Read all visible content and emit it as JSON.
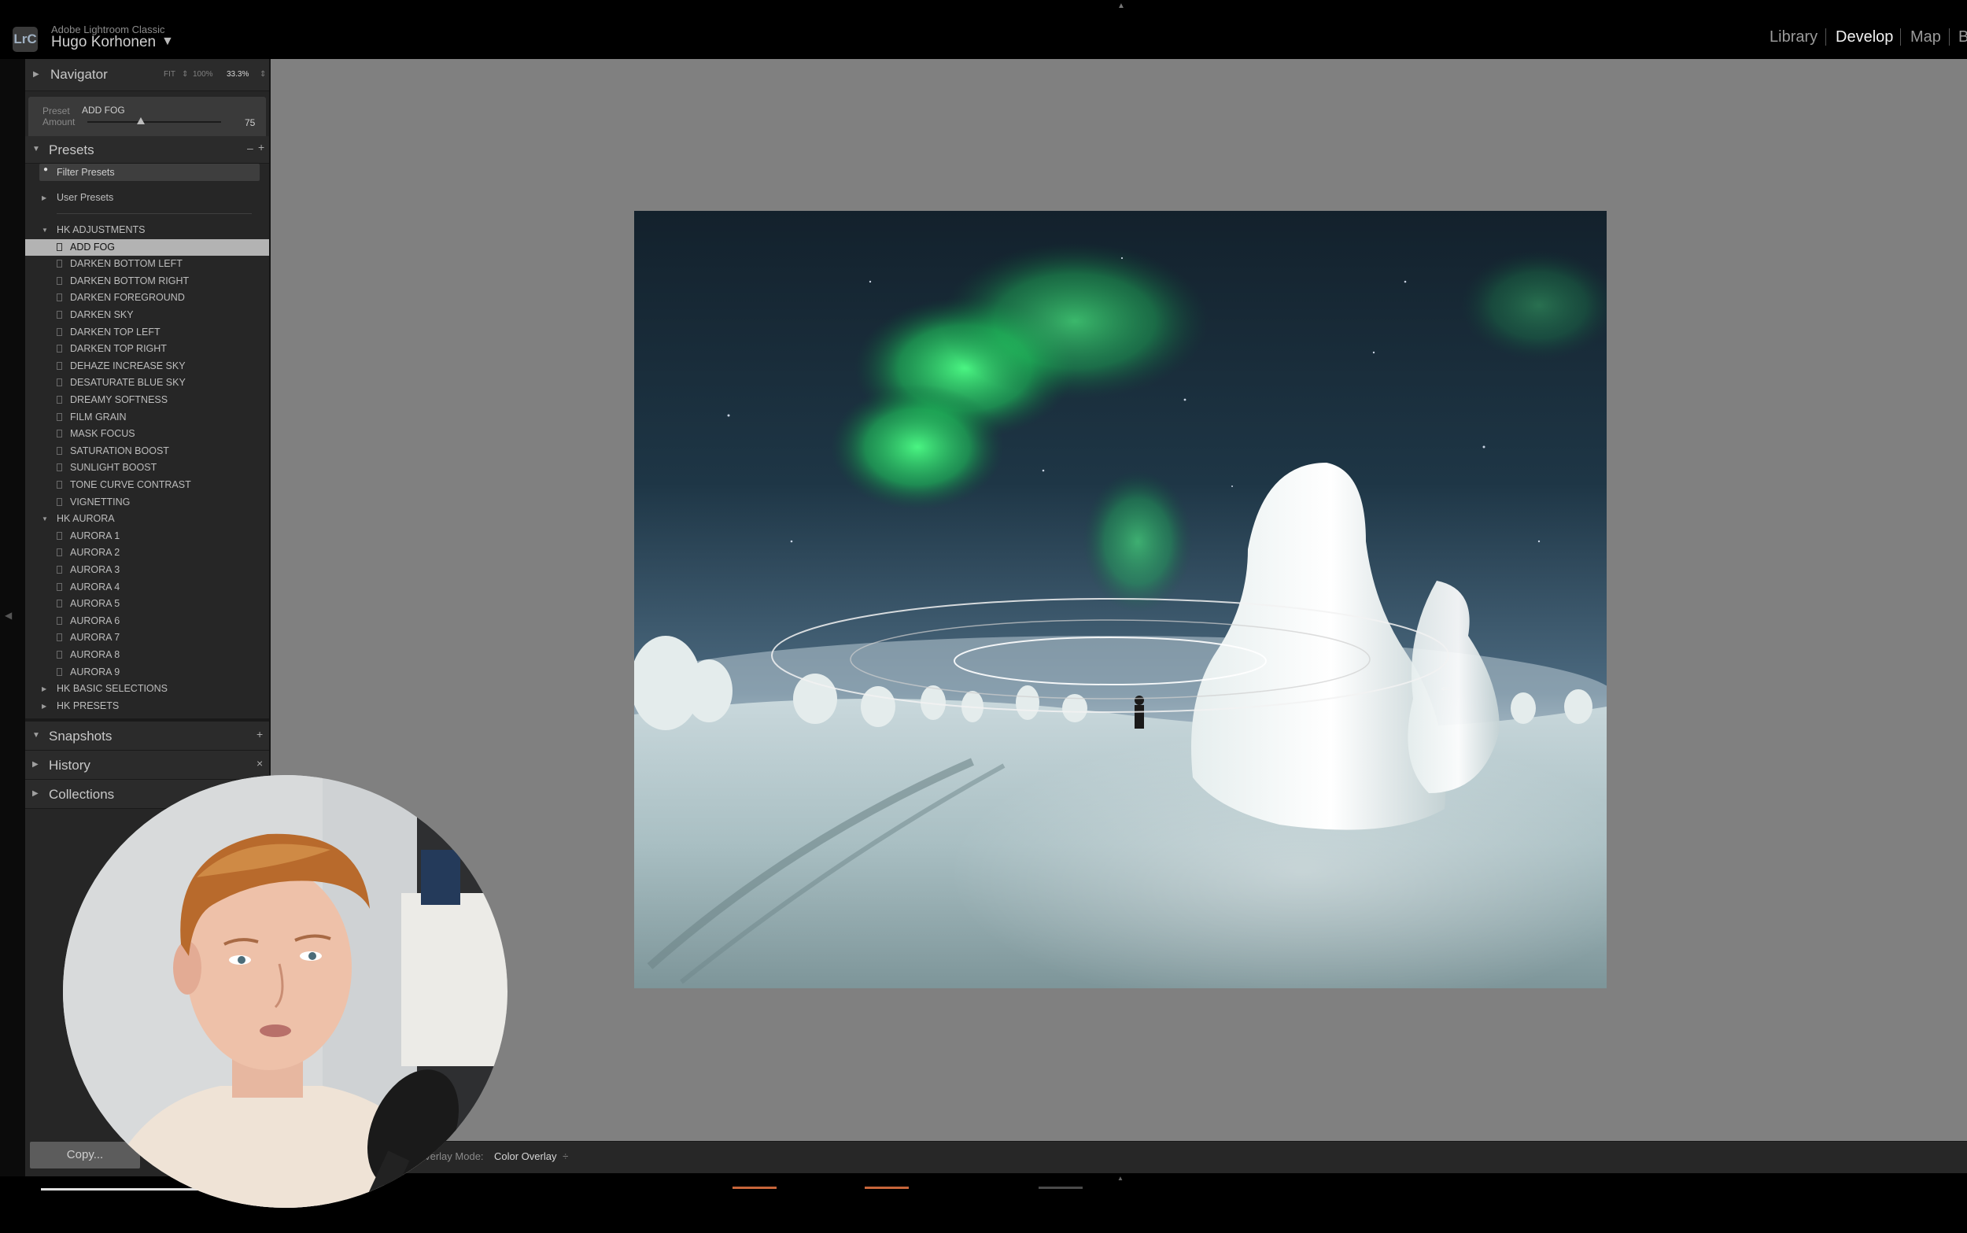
{
  "app": {
    "logo": "LrC",
    "name": "Adobe Lightroom Classic",
    "user": "Hugo Korhonen",
    "user_caret": "▼"
  },
  "modules": [
    "Library",
    "Develop",
    "Map",
    "B"
  ],
  "active_module": "Develop",
  "navigator": {
    "title": "Navigator",
    "zoom_options": [
      "FIT",
      "100%",
      "33.3%"
    ]
  },
  "preset_amount": {
    "preset_label": "Preset",
    "preset_name": "ADD FOG",
    "amount_label": "Amount",
    "amount_value": "75",
    "amount_fraction": 0.75
  },
  "presets": {
    "title": "Presets",
    "minus": "–",
    "plus": "+",
    "filter_placeholder": "Filter Presets",
    "user_presets": "User Presets",
    "groups": [
      {
        "name": "HK ADJUSTMENTS",
        "expanded": true,
        "items": [
          "ADD FOG",
          "DARKEN BOTTOM LEFT",
          "DARKEN BOTTOM RIGHT",
          "DARKEN FOREGROUND",
          "DARKEN SKY",
          "DARKEN TOP LEFT",
          "DARKEN TOP RIGHT",
          "DEHAZE INCREASE SKY",
          "DESATURATE BLUE SKY",
          "DREAMY SOFTNESS",
          "FILM GRAIN",
          "MASK FOCUS",
          "SATURATION BOOST",
          "SUNLIGHT BOOST",
          "TONE CURVE CONTRAST",
          "VIGNETTING"
        ]
      },
      {
        "name": "HK AURORA",
        "expanded": true,
        "items": [
          "AURORA 1",
          "AURORA 2",
          "AURORA 3",
          "AURORA 4",
          "AURORA 5",
          "AURORA 6",
          "AURORA 7",
          "AURORA 8",
          "AURORA 9"
        ]
      },
      {
        "name": "HK BASIC SELECTIONS",
        "expanded": false,
        "items": []
      },
      {
        "name": "HK PRESETS",
        "expanded": false,
        "items": []
      }
    ],
    "selected": "ADD FOG"
  },
  "panels": [
    {
      "title": "Snapshots",
      "action": "+"
    },
    {
      "title": "History",
      "action": "×"
    },
    {
      "title": "Collections",
      "action": ""
    }
  ],
  "copy_button": "Copy...",
  "toolbar": {
    "overlay_mode_label": "Overlay Mode:",
    "overlay_mode_value": "Color Overlay",
    "overlay_caret": "÷"
  },
  "colors": {
    "aurora_green": "#2fe06e",
    "sky_top": "#1a2f3d",
    "snow": "#eef4f4",
    "filmstrip_accent": "#c7653a"
  }
}
